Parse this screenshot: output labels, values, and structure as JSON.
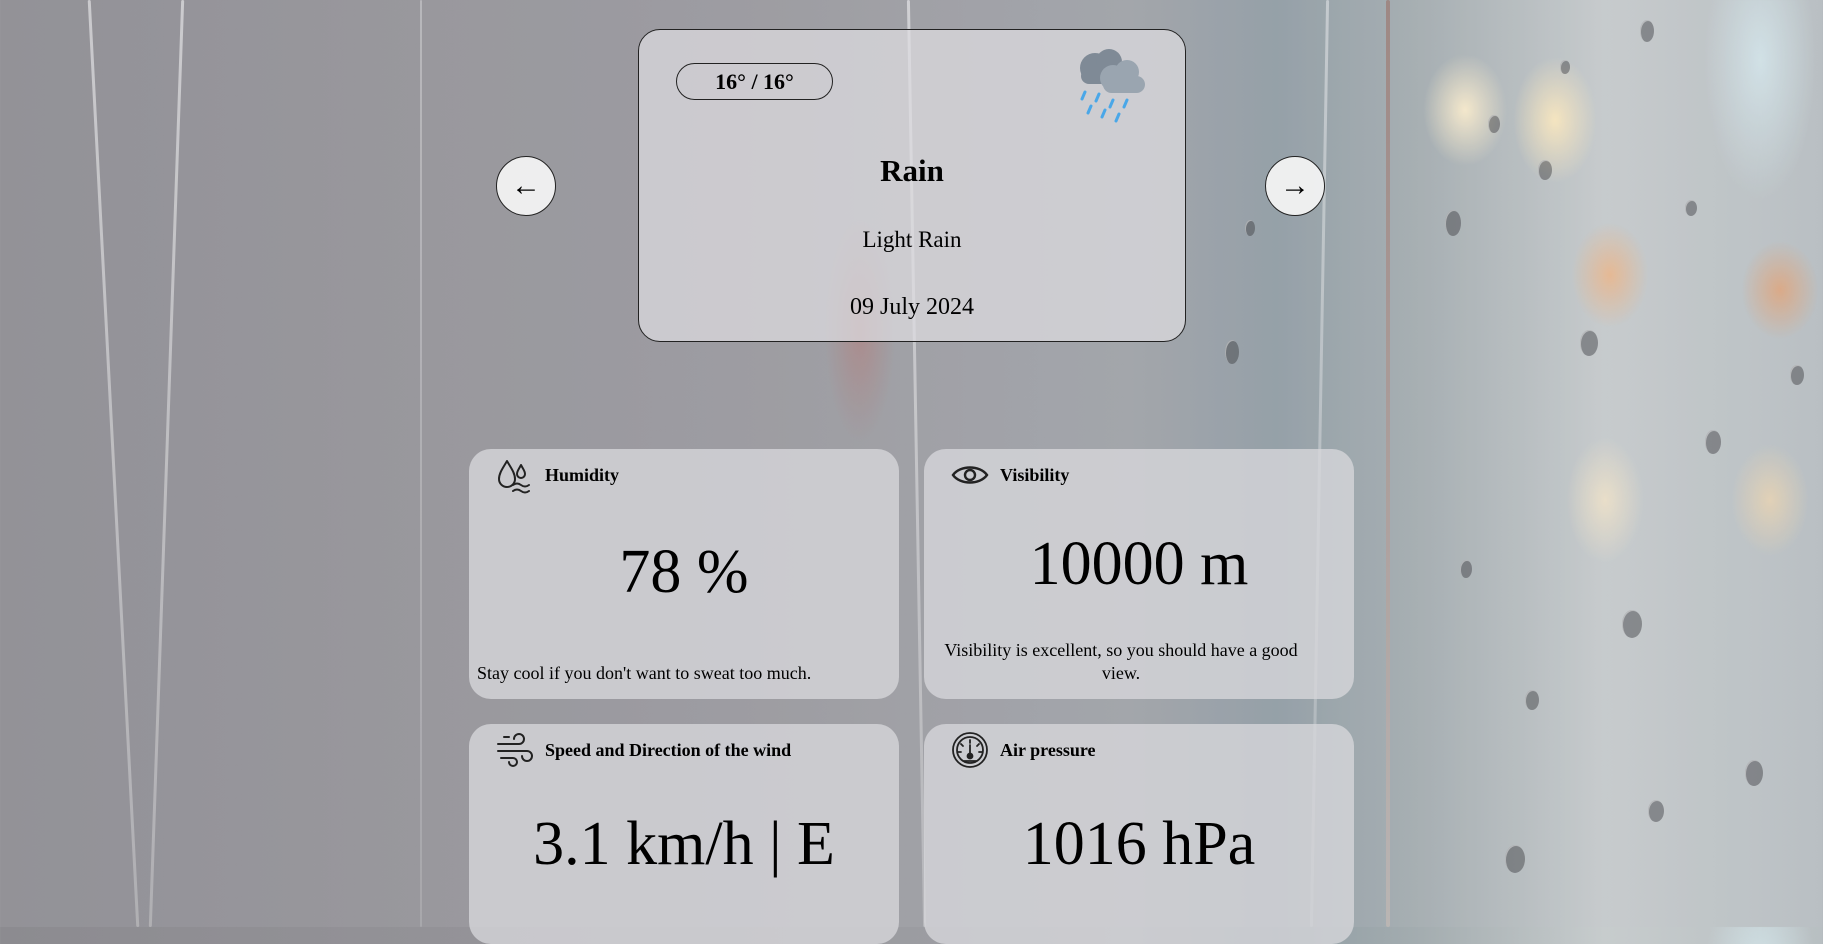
{
  "nav": {
    "prev_label": "←",
    "next_label": "→"
  },
  "forecast": {
    "temp_range": "16° / 16°",
    "condition": "Rain",
    "description": "Light Rain",
    "date": "09 July 2024",
    "icon": "rain-cloud-icon"
  },
  "tiles": {
    "humidity": {
      "title": "Humidity",
      "value": "78 %",
      "note": "Stay cool if you don't want to sweat too much.",
      "icon": "humidity-icon"
    },
    "visibility": {
      "title": "Visibility",
      "value": "10000 m",
      "note": "Visibility is excellent, so you should have a good view.",
      "icon": "eye-icon"
    },
    "wind": {
      "title": "Speed and Direction of the wind",
      "value": "3.1 km/h | E",
      "icon": "wind-icon"
    },
    "pressure": {
      "title": "Air pressure",
      "value": "1016 hPa",
      "icon": "gauge-icon"
    }
  }
}
